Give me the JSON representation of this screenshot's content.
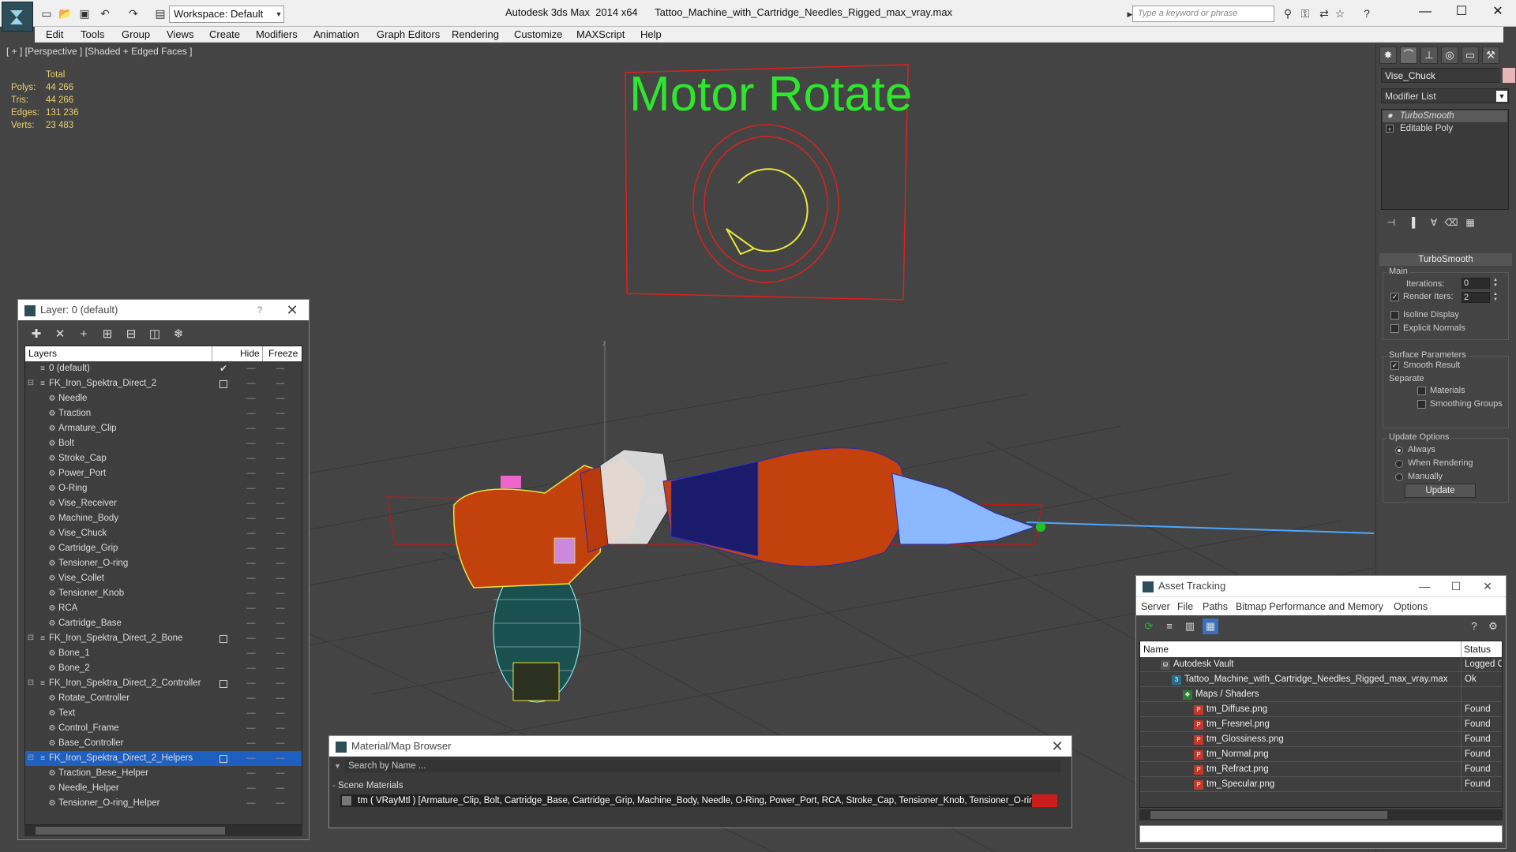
{
  "app": {
    "title": "Autodesk 3ds Max  2014 x64      Tattoo_Machine_with_Cartridge_Needles_Rigged_max_vray.max",
    "workspace": "Workspace: Default",
    "search_placeholder": "Type a keyword or phrase"
  },
  "menu": [
    "Edit",
    "Tools",
    "Group",
    "Views",
    "Create",
    "Modifiers",
    "Animation",
    "Graph Editors",
    "Rendering",
    "Customize",
    "MAXScript",
    "Help"
  ],
  "viewport": {
    "label": "[ + ] [Perspective ] [Shaded + Edged Faces ]",
    "stats": {
      "header": "Total",
      "rows": [
        {
          "label": "Polys:",
          "value": "44 266"
        },
        {
          "label": "Tris:",
          "value": "44 266"
        },
        {
          "label": "Edges:",
          "value": "131 236"
        },
        {
          "label": "Verts:",
          "value": "23 483"
        }
      ]
    },
    "scene_text": "Motor Rotate",
    "axis_label": "z",
    "colors": {
      "background": "#444444",
      "grid": "#2b2b2b",
      "body_fill": "#c2410c",
      "wire_yellow": "#e8e83a",
      "wire_blue": "#2a2aaa",
      "control_red": "#e02020",
      "control_green": "#24c024",
      "needle_line": "#4da6ff"
    }
  },
  "command_panel": {
    "object_name": "Vise_Chuck",
    "object_color": "#e9b6b8",
    "modifier_list": "Modifier List",
    "stack": [
      "TurboSmooth",
      "Editable Poly"
    ],
    "rollout": "TurboSmooth",
    "main_group": "Main",
    "iterations_label": "Iterations:",
    "iterations_value": "0",
    "render_iters_label": "Render Iters:",
    "render_iters_value": "2",
    "isoline": "Isoline Display",
    "explicit_normals": "Explicit Normals",
    "surface_group": "Surface Parameters",
    "smooth_result": "Smooth Result",
    "separate": "Separate",
    "materials": "Materials",
    "smoothing_groups": "Smoothing Groups",
    "update_group": "Update Options",
    "always": "Always",
    "when_rendering": "When Rendering",
    "manually": "Manually",
    "update_button": "Update"
  },
  "layer_window": {
    "title": "Layer: 0 (default)",
    "help": "?",
    "columns": {
      "layers": "Layers",
      "hide": "Hide",
      "freeze": "Freeze"
    },
    "rows": [
      {
        "name": "0 (default)",
        "level": 0,
        "current": true
      },
      {
        "name": "FK_Iron_Spektra_Direct_2",
        "level": 0,
        "group": true
      },
      {
        "name": "Needle",
        "level": 1
      },
      {
        "name": "Traction",
        "level": 1
      },
      {
        "name": "Armature_Clip",
        "level": 1
      },
      {
        "name": "Bolt",
        "level": 1
      },
      {
        "name": "Stroke_Cap",
        "level": 1
      },
      {
        "name": "Power_Port",
        "level": 1
      },
      {
        "name": "O-Ring",
        "level": 1
      },
      {
        "name": "Vise_Receiver",
        "level": 1
      },
      {
        "name": "Machine_Body",
        "level": 1
      },
      {
        "name": "Vise_Chuck",
        "level": 1
      },
      {
        "name": "Cartridge_Grip",
        "level": 1
      },
      {
        "name": "Tensioner_O-ring",
        "level": 1
      },
      {
        "name": "Vise_Collet",
        "level": 1
      },
      {
        "name": "Tensioner_Knob",
        "level": 1
      },
      {
        "name": "RCA",
        "level": 1
      },
      {
        "name": "Cartridge_Base",
        "level": 1
      },
      {
        "name": "FK_Iron_Spektra_Direct_2_Bone",
        "level": 0,
        "group": true
      },
      {
        "name": "Bone_1",
        "level": 1
      },
      {
        "name": "Bone_2",
        "level": 1
      },
      {
        "name": "FK_Iron_Spektra_Direct_2_Controller",
        "level": 0,
        "group": true
      },
      {
        "name": "Rotate_Controller",
        "level": 1
      },
      {
        "name": "Text",
        "level": 1
      },
      {
        "name": "Control_Frame",
        "level": 1
      },
      {
        "name": "Base_Controller",
        "level": 1
      },
      {
        "name": "FK_Iron_Spektra_Direct_2_Helpers",
        "level": 0,
        "group": true,
        "selected": true
      },
      {
        "name": "Traction_Bese_Helper",
        "level": 1
      },
      {
        "name": "Needle_Helper",
        "level": 1
      },
      {
        "name": "Tensioner_O-ring_Helper",
        "level": 1
      }
    ]
  },
  "material_browser": {
    "title": "Material/Map Browser",
    "search": "Search by Name ...",
    "section": "Scene Materials",
    "row": "tm  ( VRayMtl ) [Armature_Clip, Bolt, Cartridge_Base, Cartridge_Grip, Machine_Body, Needle, O-Ring, Power_Port, RCA, Stroke_Cap, Tensioner_Knob, Tensioner_O-ring, Tra..."
  },
  "asset_tracking": {
    "title": "Asset Tracking",
    "menu": [
      "Server",
      "File",
      "Paths",
      "Bitmap Performance and Memory",
      "Options"
    ],
    "columns": {
      "name": "Name",
      "status": "Status"
    },
    "rows": [
      {
        "name": "Autodesk Vault",
        "status": "Logged Out",
        "indent": 0,
        "icon": "vault-icon"
      },
      {
        "name": "Tattoo_Machine_with_Cartridge_Needles_Rigged_max_vray.max",
        "status": "Ok",
        "indent": 1,
        "icon": "max-file-icon"
      },
      {
        "name": "Maps / Shaders",
        "status": "",
        "indent": 2,
        "icon": "maps-folder-icon"
      },
      {
        "name": "tm_Diffuse.png",
        "status": "Found",
        "indent": 3,
        "icon": "png-icon"
      },
      {
        "name": "tm_Fresnel.png",
        "status": "Found",
        "indent": 3,
        "icon": "png-icon"
      },
      {
        "name": "tm_Glossiness.png",
        "status": "Found",
        "indent": 3,
        "icon": "png-icon"
      },
      {
        "name": "tm_Normal.png",
        "status": "Found",
        "indent": 3,
        "icon": "png-icon"
      },
      {
        "name": "tm_Refract.png",
        "status": "Found",
        "indent": 3,
        "icon": "png-icon"
      },
      {
        "name": "tm_Specular.png",
        "status": "Found",
        "indent": 3,
        "icon": "png-icon"
      }
    ]
  }
}
